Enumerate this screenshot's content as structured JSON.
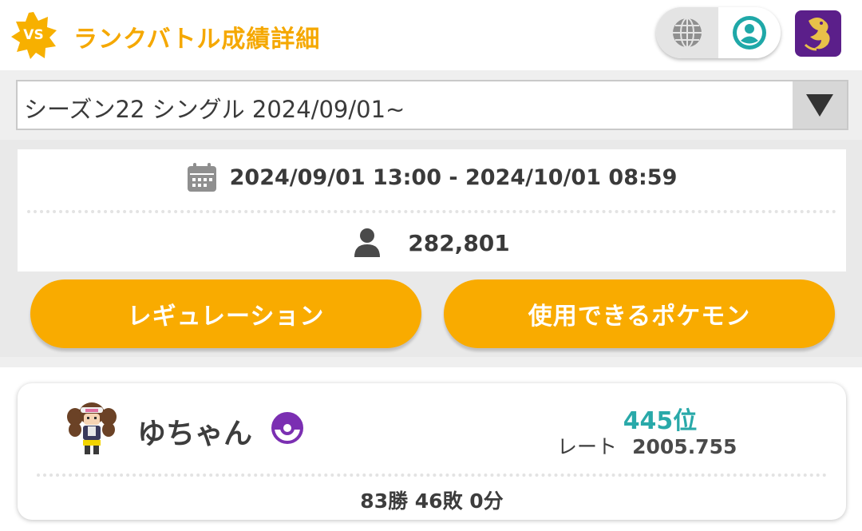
{
  "header": {
    "badge_text": "VS",
    "title": "ランクバトル成績詳細",
    "accent_color": "#f5a800",
    "icons": [
      "globe-icon",
      "person-icon",
      "dragon-avatar-icon"
    ]
  },
  "season_select": {
    "value": "シーズン22 シングル 2024/09/01~"
  },
  "season_info": {
    "period": "2024/09/01 13:00 - 2024/10/01 08:59",
    "player_count": "282,801"
  },
  "buttons": {
    "regulation": "レギュレーション",
    "usable_pokemon": "使用できるポケモン",
    "button_color": "#f9ab00"
  },
  "player": {
    "name": "ゆちゃん",
    "rank": "445位",
    "rate_label": "レート",
    "rate_value": "2005.755",
    "record": "83勝 46敗 0分",
    "rank_color": "#29a9a9"
  }
}
